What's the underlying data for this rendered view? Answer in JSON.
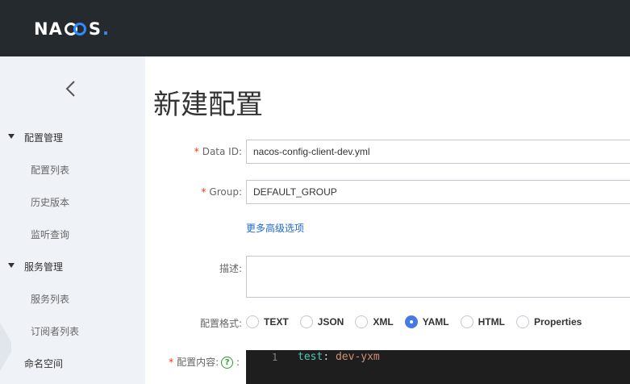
{
  "app": {
    "logo_text_left": "NA",
    "logo_text_right": "S",
    "logo_dot": "."
  },
  "sidebar": {
    "groups": [
      {
        "label": "配置管理",
        "items": [
          "配置列表",
          "历史版本",
          "监听查询"
        ]
      },
      {
        "label": "服务管理",
        "items": [
          "服务列表",
          "订阅者列表"
        ]
      }
    ],
    "namespace_label": "命名空间"
  },
  "page": {
    "title": "新建配置"
  },
  "form": {
    "data_id_label": "Data ID:",
    "data_id_value": "nacos-config-client-dev.yml",
    "group_label": "Group:",
    "group_value": "DEFAULT_GROUP",
    "advanced_link": "更多高级选项",
    "desc_label": "描述:",
    "format_label": "配置格式:",
    "formats": [
      "TEXT",
      "JSON",
      "XML",
      "YAML",
      "HTML",
      "Properties"
    ],
    "selected_format": "YAML",
    "content_label": "配置内容:",
    "content_colon": ":",
    "help_symbol": "?",
    "required_mark": "*"
  },
  "editor": {
    "line_number": "1",
    "key": "test",
    "sep": ": ",
    "value": "dev-yxm"
  },
  "colors": {
    "topbar": "#252a2f",
    "sidebar": "#eff3f8",
    "accent": "#4678e6",
    "link": "#1d6ad9",
    "required": "#ff3000",
    "editor_bg": "#1e1e1e"
  }
}
